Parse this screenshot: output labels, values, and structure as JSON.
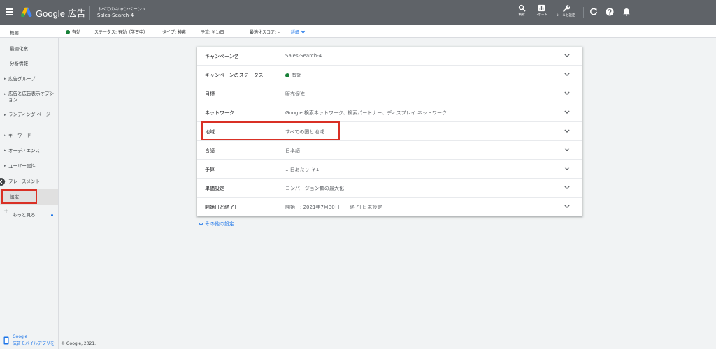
{
  "topbar": {
    "product_name": "Google 広告",
    "breadcrumb_parent": "すべてのキャンペーン",
    "breadcrumb_chevron": "›",
    "breadcrumb_current": "Sales-Search-4",
    "tools": [
      {
        "label": "検索",
        "icon": "search-icon"
      },
      {
        "label": "レポート",
        "icon": "reports-icon"
      },
      {
        "label": "ツールと設定",
        "icon": "wrench-icon"
      }
    ],
    "icons": [
      "refresh-icon",
      "help-icon",
      "bell-icon"
    ],
    "colors": {
      "bar": "#5f6368",
      "logo_blue": "#4285f4",
      "logo_yellow": "#fbbc04",
      "logo_green": "#34a853"
    }
  },
  "statusbar": {
    "status_value": "有効",
    "status_label": "ステータス:",
    "status_detail": "有効（学習中）",
    "type_label": "タイプ:",
    "type_value": "検索",
    "budget_label": "予算:",
    "budget_value": "¥ 1/日",
    "score_label": "最適化スコア:",
    "score_value": "–",
    "detail_link": "詳細",
    "status_color": "#188038"
  },
  "sidebar": {
    "items": [
      {
        "label": "概要",
        "expandable": false
      },
      {
        "label": "最適化案",
        "expandable": false
      },
      {
        "label": "分析情報",
        "expandable": false
      },
      {
        "label": "広告グループ",
        "expandable": true
      },
      {
        "label": "広告と広告表示オプション",
        "expandable": true
      },
      {
        "label": "ランディング ページ",
        "expandable": true
      },
      {
        "label": "キーワード",
        "expandable": true
      },
      {
        "label": "オーディエンス",
        "expandable": true
      },
      {
        "label": "ユーザー属性",
        "expandable": true
      },
      {
        "label": "プレースメント",
        "expandable": true
      },
      {
        "label": "設定",
        "expandable": false,
        "selected": true
      }
    ],
    "more_label": "もっと見る",
    "mobile_promo": {
      "line1": "Google",
      "line2": "広告モバイルアプリを"
    }
  },
  "settings": {
    "rows": [
      {
        "label": "キャンペーン名",
        "value": "Sales-Search-4"
      },
      {
        "label": "キャンペーンのステータス",
        "value": "有効",
        "status_dot": true
      },
      {
        "label": "目標",
        "value": "販売促進"
      },
      {
        "label": "ネットワーク",
        "value": "Google 検索ネットワーク、検索パートナー、ディスプレイ ネットワーク"
      },
      {
        "label": "地域",
        "value": "すべての国と地域"
      },
      {
        "label": "言語",
        "value": "日本語"
      },
      {
        "label": "予算",
        "value": "1 日あたり ￥1"
      },
      {
        "label": "単価設定",
        "value": "コンバージョン数の最大化"
      },
      {
        "label": "開始日と終了日",
        "value": "開始日: 2021年7月30日　　終了日: 未設定"
      }
    ],
    "other_settings_link": "その他の設定"
  },
  "annotation_color": "#d93025",
  "footer": {
    "copyright": "© Google, 2021."
  }
}
